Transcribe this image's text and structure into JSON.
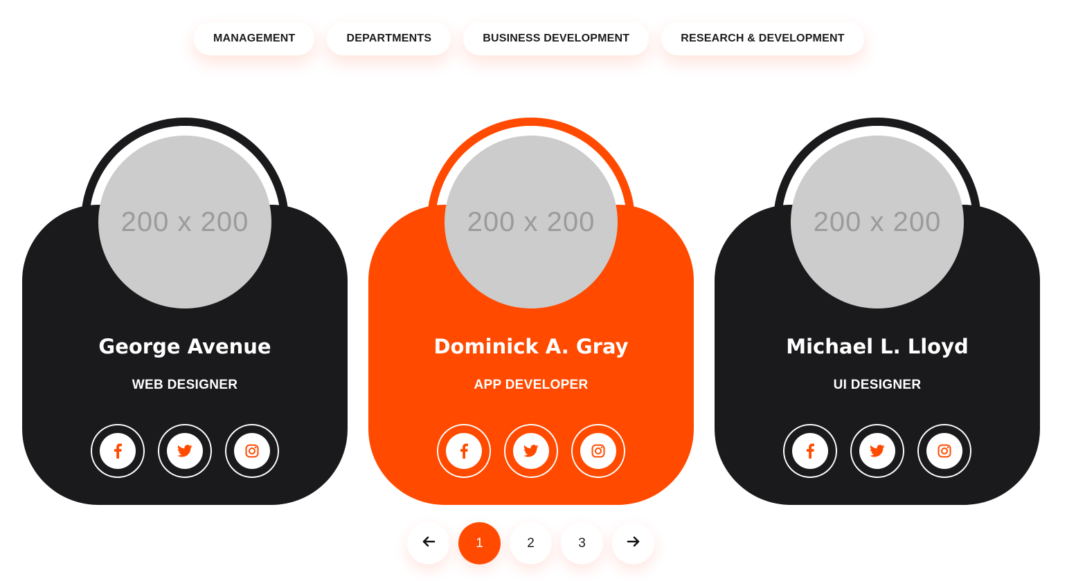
{
  "colors": {
    "accent": "#ff4a00",
    "dark": "#1a1a1c",
    "white": "#ffffff",
    "placeholder_bg": "#cccccc",
    "placeholder_text": "#9b9b9b"
  },
  "tabs": [
    {
      "label": "MANAGEMENT"
    },
    {
      "label": "DEPARTMENTS"
    },
    {
      "label": "BUSINESS DEVELOPMENT"
    },
    {
      "label": "RESEARCH & DEVELOPMENT"
    }
  ],
  "cards": [
    {
      "avatar_text": "200 x 200",
      "name": "George Avenue",
      "role": "WEB DESIGNER",
      "highlighted": false,
      "socials": [
        "facebook-icon",
        "twitter-icon",
        "instagram-icon"
      ]
    },
    {
      "avatar_text": "200 x 200",
      "name": "Dominick A. Gray",
      "role": "APP DEVELOPER",
      "highlighted": true,
      "socials": [
        "facebook-icon",
        "twitter-icon",
        "instagram-icon"
      ]
    },
    {
      "avatar_text": "200 x 200",
      "name": "Michael L. Lloyd",
      "role": "UI DESIGNER",
      "highlighted": false,
      "socials": [
        "facebook-icon",
        "twitter-icon",
        "instagram-icon"
      ]
    }
  ],
  "pagination": {
    "prev_icon": "arrow-left-icon",
    "next_icon": "arrow-right-icon",
    "pages": [
      "1",
      "2",
      "3"
    ],
    "active_page": "1"
  }
}
